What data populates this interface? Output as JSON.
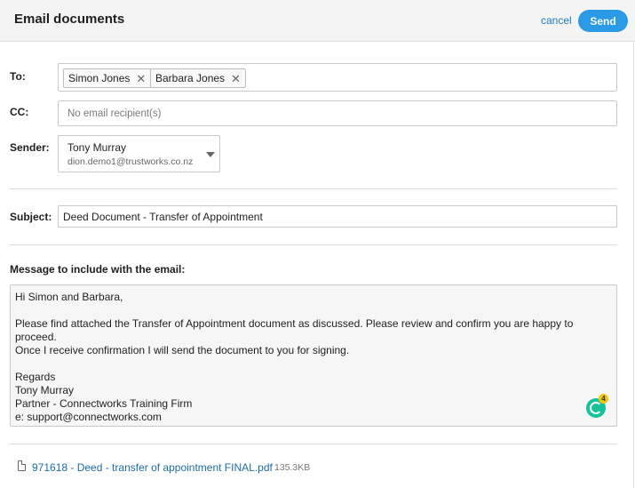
{
  "header": {
    "title": "Email documents",
    "cancel_label": "cancel",
    "send_label": "Send"
  },
  "to": {
    "label": "To:",
    "recipients": [
      {
        "name": "Simon Jones"
      },
      {
        "name": "Barbara Jones"
      }
    ],
    "remove_glyph": "✕"
  },
  "cc": {
    "label": "CC:",
    "value": "",
    "placeholder": "No email recipient(s)"
  },
  "sender": {
    "label": "Sender:",
    "name": "Tony Murray",
    "email": "dion.demo1@trustworks.co.nz"
  },
  "subject": {
    "label": "Subject:",
    "value": "Deed Document - Transfer of Appointment"
  },
  "message": {
    "label": "Message to include with the email:",
    "value": "Hi Simon and Barbara,\n\nPlease find attached the Transfer of Appointment document as discussed. Please review and confirm you are happy to proceed.\nOnce I receive confirmation I will send the document to you for signing.\n\nRegards\nTony Murray\nPartner - Connectworks Training Firm\ne: support@connectworks.com"
  },
  "grammarly": {
    "icon": "grammarly-icon",
    "badge_count": "4",
    "color": "#15c39a"
  },
  "attachment": {
    "icon": "document-icon",
    "filename": "971618 - Deed - transfer of appointment FINAL.pdf",
    "size": "135.3KB"
  },
  "colors": {
    "accent": "#2a9ae6",
    "link": "#1a7bbf"
  }
}
